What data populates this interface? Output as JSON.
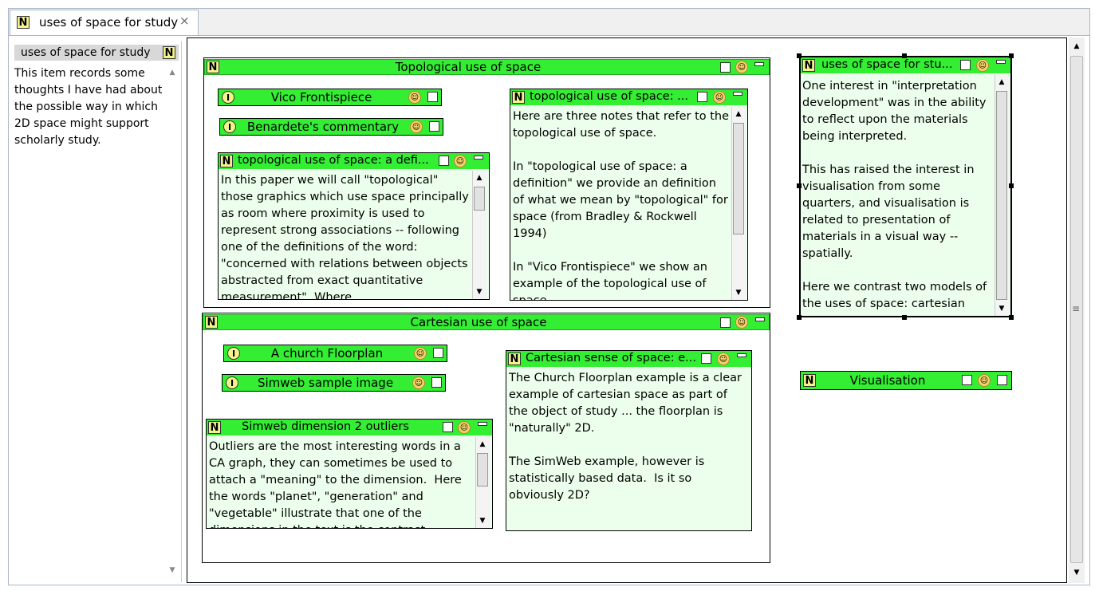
{
  "tab": {
    "label": "uses of space for study",
    "close_icon": "×"
  },
  "side_panel": {
    "title": "uses of space for study",
    "text": "This item records some thoughts I have had about the possible way in which 2D space might support scholarly study."
  },
  "topological": {
    "title": "Topological use of space",
    "items": [
      "Vico Frontispiece",
      "Benardete's commentary"
    ],
    "note_def_title": "topological use of space: a defi...",
    "note_def_body": "In this paper we will call \"topological\" those graphics which use space principally as room where proximity is used to represent strong associations -- following one of the definitions of the word: \"concerned with relations between objects abstracted from exact quantitative measurement\". Where",
    "note_main_title": "topological use of space: ...",
    "note_main_body": "Here are three notes that refer to the topological use of space.\n\nIn \"topological use of space: a definition\" we provide an definition of what we mean by \"topological\" for space (from Bradley & Rockwell 1994)\n\nIn \"Vico Frontispiece\" we show an example of the topological use of space"
  },
  "cartesian": {
    "title": "Cartesian use of space",
    "items": [
      "A church Floorplan",
      "Simweb sample image"
    ],
    "note_outliers_title": "Simweb dimension 2 outliers",
    "note_outliers_body": "Outliers are the most interesting words in a CA graph, they can sometimes be used to attach a \"meaning\" to the dimension.  Here the words \"planet\", \"generation\" and \"vegetable\" illustrate that one of the dimensions in the text is the contrast",
    "note_sense_title": "Cartesian sense of space: e...",
    "note_sense_body": "The Church Floorplan example is a clear example of cartesian space as part of the object of study ... the floorplan is \"naturally\" 2D.\n\nThe SimWeb example, however is statistically based data.  Is it so obviously 2D?"
  },
  "uses_note": {
    "title": "uses of space for stu...",
    "body": "One interest in \"interpretation development\" was in the ability to reflect upon the materials being interpreted.\n\nThis has raised the interest in visualisation from some quarters, and visualisation is related to presentation of materials in a visual way -- spatially.\n\nHere we contrast two models of the uses of space: cartesian"
  },
  "visualisation": {
    "title": "Visualisation"
  },
  "icons": {
    "note": "N",
    "item": "I"
  },
  "colors": {
    "header_green": "#33ee33",
    "note_bg": "#ecffec"
  }
}
